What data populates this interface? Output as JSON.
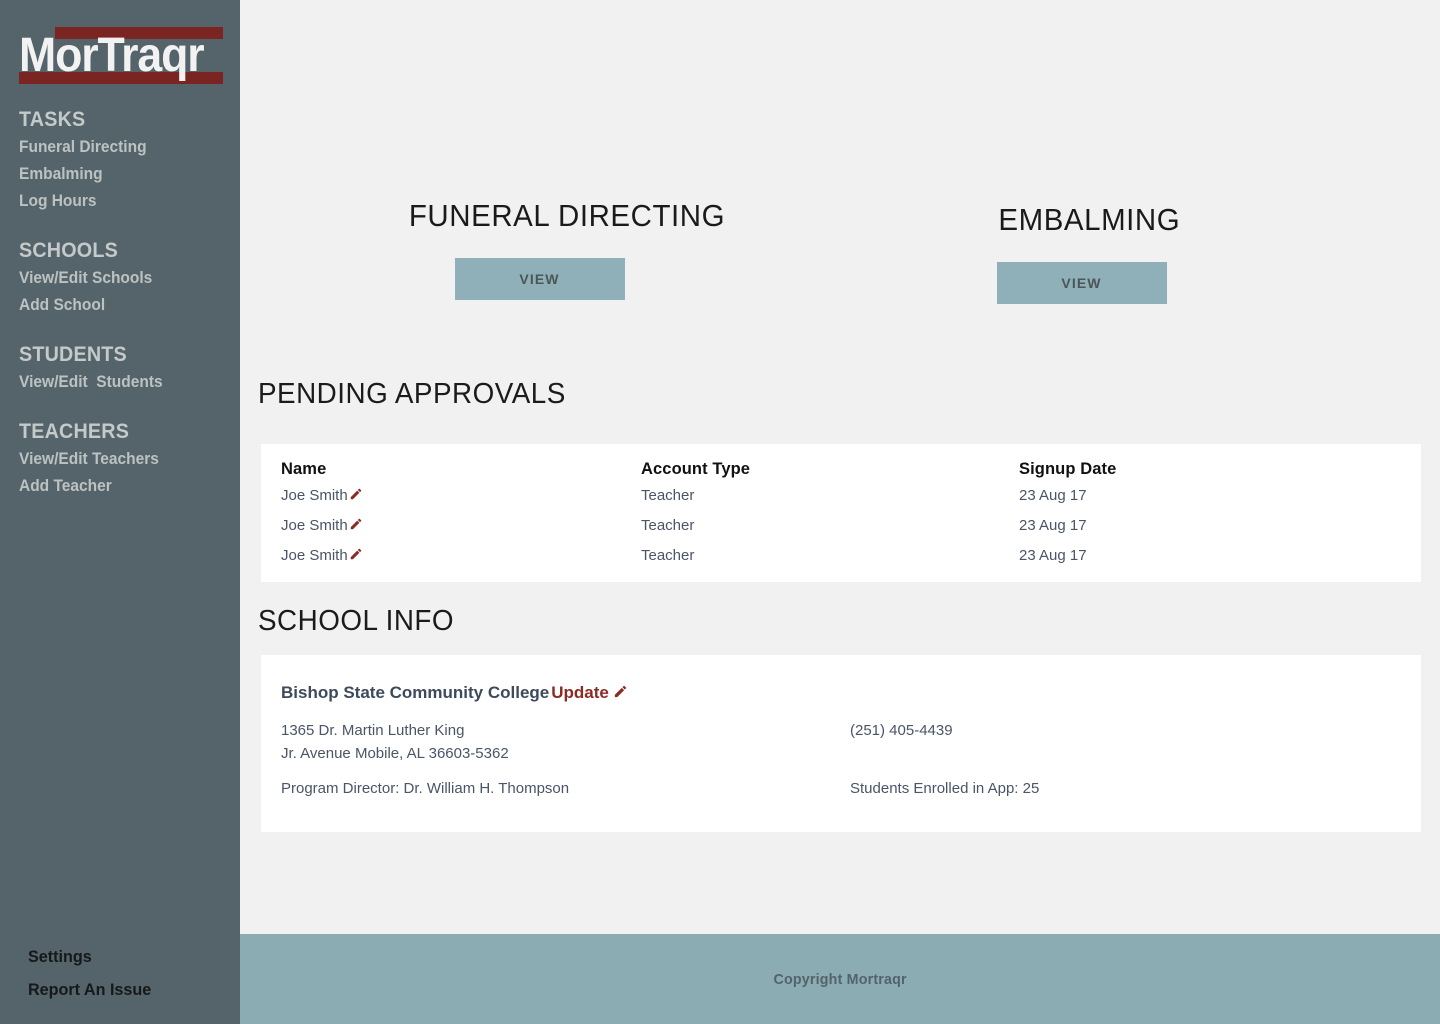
{
  "brand": {
    "logo_text": "MorTraqr",
    "accent_red": "#7a2522",
    "sidebar_bg": "#54646a",
    "footer_bg": "#8cacb3",
    "button_bg": "#8fb0b8"
  },
  "sidebar": {
    "groups": [
      {
        "heading": "TASKS",
        "items": [
          {
            "label": "Funeral Directing"
          },
          {
            "label": "Embalming"
          },
          {
            "label": "Log Hours"
          }
        ]
      },
      {
        "heading": "SCHOOLS",
        "items": [
          {
            "label": "View/Edit Schools"
          },
          {
            "label": "Add School"
          }
        ]
      },
      {
        "heading": "STUDENTS",
        "items": [
          {
            "label": "View/Edit  Students"
          }
        ]
      },
      {
        "heading": "TEACHERS",
        "items": [
          {
            "label": "View/Edit Teachers"
          },
          {
            "label": "Add Teacher"
          }
        ]
      }
    ],
    "bottom": [
      {
        "label": "Settings"
      },
      {
        "label": "Report An Issue"
      }
    ]
  },
  "tasks": [
    {
      "title": "FUNERAL DIRECTING",
      "button_label": "VIEW"
    },
    {
      "title": "EMBALMING",
      "button_label": "VIEW"
    }
  ],
  "pending_approvals": {
    "section_title": "PENDING APPROVALS",
    "columns": [
      "Name",
      "Account Type",
      "Signup Date"
    ],
    "rows": [
      {
        "name": "Joe Smith",
        "account_type": "Teacher",
        "signup_date": "23 Aug 17"
      },
      {
        "name": "Joe Smith",
        "account_type": "Teacher",
        "signup_date": "23 Aug 17"
      },
      {
        "name": "Joe Smith",
        "account_type": "Teacher",
        "signup_date": "23 Aug 17"
      }
    ]
  },
  "school_info": {
    "section_title": "SCHOOL INFO",
    "school_name": "Bishop State Community College",
    "update_label": "Update",
    "address_line_1": "1365 Dr. Martin Luther King",
    "address_line_2": "Jr. Avenue Mobile, AL 36603-5362",
    "program_director": "Program Director: Dr. William H. Thompson",
    "phone": "(251) 405-4439",
    "students_enrolled": "Students Enrolled in App: 25"
  },
  "footer": {
    "copyright": "Copyright Mortraqr"
  }
}
